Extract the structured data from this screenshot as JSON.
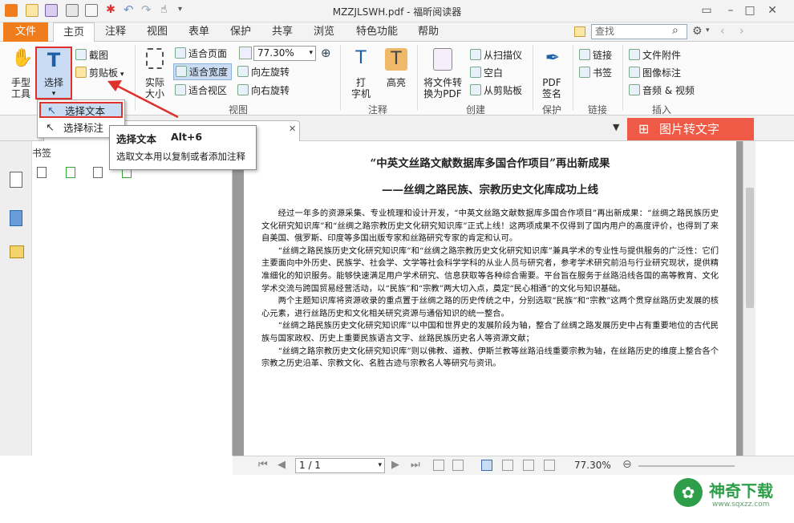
{
  "window": {
    "title": "MZZJLSWH.pdf - 福昕阅读器"
  },
  "tabs": [
    "文件",
    "主页",
    "注释",
    "视图",
    "表单",
    "保护",
    "共享",
    "浏览",
    "特色功能",
    "帮助"
  ],
  "search": {
    "placeholder": "查找"
  },
  "ribbon": {
    "hand_tool": "手型\n工具",
    "select": "选择",
    "snapshot": "截图",
    "clipboard": "剪贴板",
    "actual_size": "实际\n大小",
    "fit_page": "适合页面",
    "fit_width": "适合宽度",
    "fit_visible": "适合视区",
    "zoom_value": "77.30%",
    "rotate_left": "向左旋转",
    "rotate_right": "向右旋转",
    "view_group": "视图",
    "typewriter": "打\n字机",
    "highlight": "高亮",
    "annotate_group": "注释",
    "convert_pdf": "将文件转\n换为PDF",
    "from_scanner": "从扫描仪",
    "blank": "空白",
    "from_clipboard": "从剪贴板",
    "create_group": "创建",
    "pdf_sign": "PDF\n签名",
    "protect_group": "保护",
    "link": "链接",
    "bookmark": "书签",
    "link_group": "链接",
    "file_attach": "文件附件",
    "image_annot": "图像标注",
    "audio_video": "音频 & 视频",
    "insert_group": "插入"
  },
  "dropdown": {
    "select_text": "选择文本",
    "select_annot": "选择标注"
  },
  "tooltip": {
    "title": "选择文本",
    "shortcut": "Alt+6",
    "desc": "选取文本用以复制或者添加注释"
  },
  "sub_banner": "图片转文字",
  "left_panel": {
    "title": "书签"
  },
  "document": {
    "title": "“中英文丝路文献数据库多国合作项目”再出新成果",
    "subtitle": "——丝绸之路民族、宗教历史文化库成功上线",
    "paragraphs": [
      "经过一年多的资源采集、专业梳理和设计开发，“中英文丝路文献数据库多国合作项目”再出新成果：“丝绸之路民族历史文化研究知识库”和“丝绸之路宗教历史文化研究知识库”正式上线！这两项成果不仅得到了国内用户的高度评价，也得到了来自美国、俄罗斯、印度等多国出版专家和丝路研究专家的肯定和认可。",
      "“丝绸之路民族历史文化研究知识库”和“丝绸之路宗教历史文化研究知识库”兼具学术的专业性与提供服务的广泛性：它们主要面向中外历史、民族学、社会学、文学等社会科学学科的从业人员与研究者，参考学术研究前沿与行业研究现状，提供精准细化的知识服务。能够快速满足用户学术研究、信息获取等各种综合需要。平台旨在服务于丝路沿线各国的高等教育、文化学术交流与跨国贸易经营活动，以“民族”和“宗教”两大切入点，奠定“民心相通”的文化与知识基础。",
      "两个主题知识库将资源收录的重点置于丝绸之路的历史传统之中，分别选取“民族”和“宗教”这两个贯穿丝路历史发展的核心元素，进行丝路历史和文化相关研究资源与通俗知识的统一整合。",
      "“丝绸之路民族历史文化研究知识库”以中国和世界史的发展阶段为轴，整合了丝绸之路发展历史中占有重要地位的古代民族与国家政权、历史上重要民族语言文字、丝路民族历史名人等资源文献；",
      "“丝绸之路宗教历史文化研究知识库”则以佛教、道教、伊斯兰教等丝路沿线重要宗教为轴，在丝路历史的维度上整合各个宗教之历史沿革、宗教文化、名胜古迹与宗教名人等研究与资讯。"
    ]
  },
  "status": {
    "page": "1 / 1",
    "zoom": "77.30%"
  },
  "watermark": "神奇下载",
  "watermark_url": "www.sqxzz.com",
  "colors": {
    "accent": "#f07c1c",
    "highlight_red": "#e0302a",
    "banner": "#ee5a45"
  }
}
